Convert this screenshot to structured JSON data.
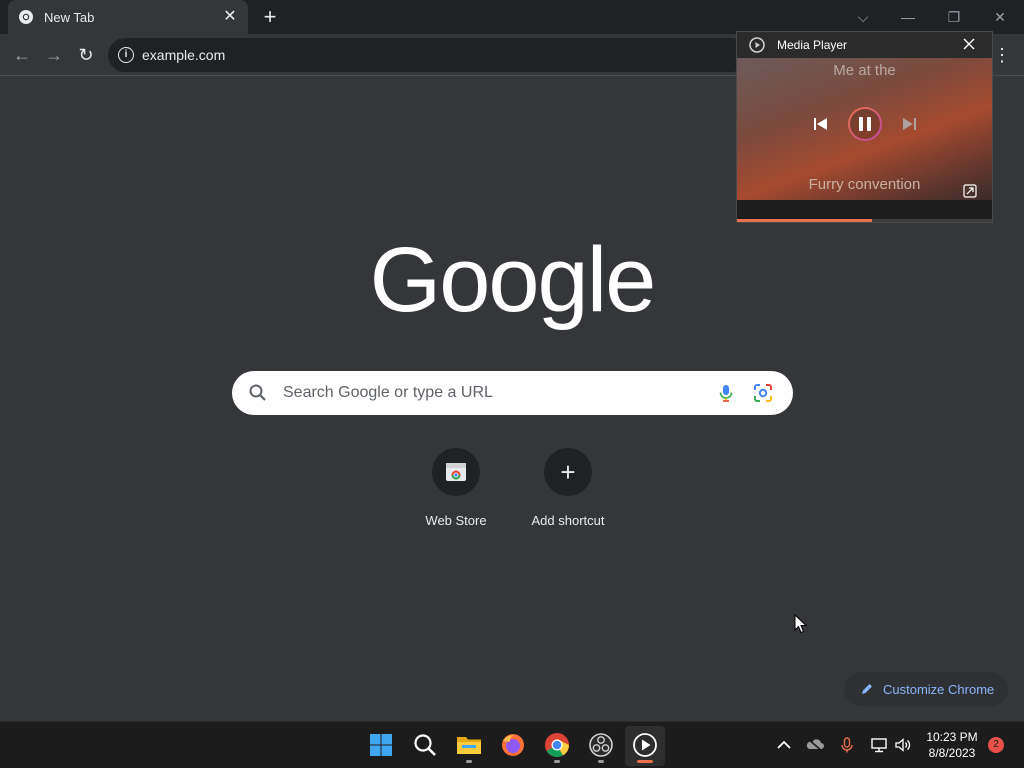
{
  "tab": {
    "title": "New Tab",
    "close_glyph": "✕",
    "new_tab_glyph": "+"
  },
  "window_controls": {
    "dropdown": "⌵",
    "minimize": "—",
    "restore": "❐",
    "close": "✕"
  },
  "toolbar": {
    "back_glyph": "←",
    "forward_glyph": "→",
    "reload_glyph": "↻",
    "url_host": "example.com",
    "url_path": "",
    "menu_glyph": "⋮"
  },
  "logo": "Google",
  "search": {
    "placeholder": "Search Google or type a URL"
  },
  "shortcuts": [
    {
      "label": "Web Store",
      "icon": "web-store-icon"
    },
    {
      "label": "Add shortcut",
      "icon": "plus-icon",
      "glyph": "+"
    }
  ],
  "customize": {
    "label": "Customize Chrome"
  },
  "media_player": {
    "title": "Media Player",
    "caption_top": "Me at the",
    "caption_bottom": "Furry convention",
    "progress_fraction": 0.53
  },
  "taskbar": {
    "apps": [
      "windows-start-icon",
      "search-icon",
      "file-explorer-icon",
      "firefox-icon",
      "chrome-icon",
      "obs-icon",
      "media-player-icon"
    ],
    "time": "10:23 PM",
    "date": "8/8/2023",
    "notification_count": "2"
  },
  "colors": {
    "accent": "#8ab4f8",
    "progress": "#e8704a",
    "notification": "#e8504a"
  }
}
